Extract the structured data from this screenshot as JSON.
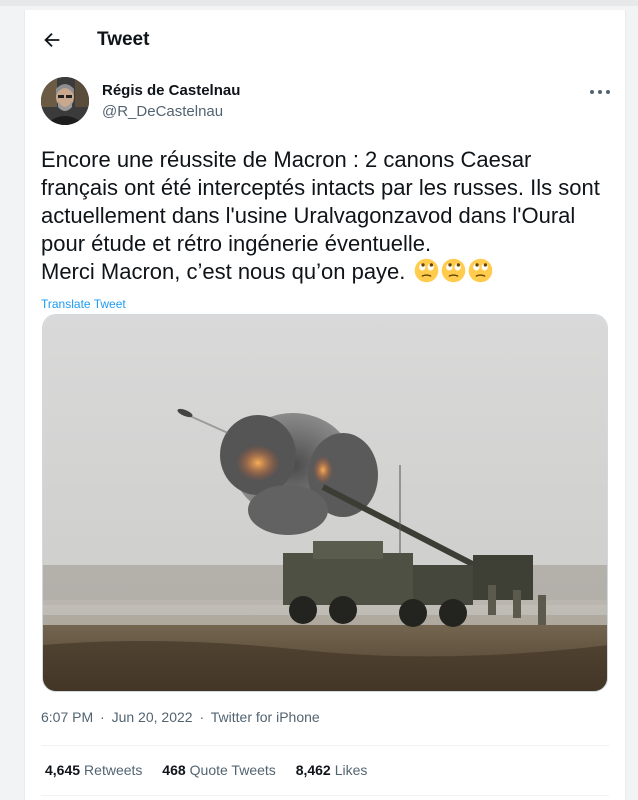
{
  "header": {
    "title": "Tweet",
    "back_icon": "arrow-left-icon"
  },
  "author": {
    "name": "Régis de Castelnau",
    "handle": "@R_DeCastelnau"
  },
  "tweet": {
    "text": "Encore une réussite de Macron : 2 canons Caesar français ont été interceptés intacts par les russes. Ils sont actuellement dans l'usine Uralvagonzavod dans l'Oural pour étude et rétro ingénerie éventuelle.\nMerci Macron, c’est nous qu’on paye.",
    "emoji_icon": "face-with-rolling-eyes-emoji",
    "emoji_count": 3,
    "translate_label": "Translate Tweet",
    "time": "6:07 PM",
    "date": "Jun 20, 2022",
    "source": "Twitter for iPhone",
    "separator": "·"
  },
  "stats": {
    "retweets_count": "4,645",
    "retweets_label": "Retweets",
    "quotes_count": "468",
    "quotes_label": "Quote Tweets",
    "likes_count": "8,462",
    "likes_label": "Likes"
  },
  "colors": {
    "link": "#1d9bf0",
    "secondary_text": "#536471",
    "primary_text": "#0f1419"
  }
}
